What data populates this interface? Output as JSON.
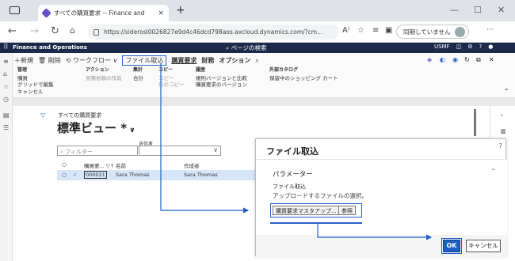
{
  "browser": {
    "tab_title": "すべての購買要求 -- Finance and",
    "tab_close": "×",
    "new_tab": "+",
    "url": "https://siderosl0026827e9d4c46dcd798aos.axcloud.dynamics.com/?cm...",
    "sync_label": "同期していません",
    "more": "···",
    "minimize": "—",
    "maximize": "☐",
    "close": "✕"
  },
  "app": {
    "name": "Finance and Operations",
    "search": "ページの検索",
    "company": "USMF"
  },
  "action_pane": {
    "new": "＋新規",
    "delete": "削除",
    "workflow": "ワークフロー",
    "file_import": "ファイル取込",
    "purchase_requisition": "購買要求",
    "finance": "財務",
    "options": "オプション",
    "groups": [
      {
        "header": "管理",
        "lines": [
          "購買",
          "グリッドで編集",
          "キャンセル"
        ]
      },
      {
        "header": "アクション",
        "lines": [
          "見積依頼の作成"
        ]
      },
      {
        "header": "集計",
        "lines": [
          "合計"
        ]
      },
      {
        "header": "コピー",
        "lines": [
          "コピー",
          "行のコピー"
        ]
      },
      {
        "header": "履歴",
        "lines": [
          "規則バージョンと比較",
          "購買要求のバージョン"
        ]
      },
      {
        "header": "外部カタログ",
        "lines": [
          "保留中のショッピング カート"
        ]
      }
    ]
  },
  "list": {
    "breadcrumb": "すべての購買要求",
    "view_title": "標準ビュー *",
    "filter_placeholder": "フィルター",
    "lookup_label": "送信者",
    "columns": [
      "購買要...",
      "名前",
      "作成者"
    ],
    "row": {
      "id": "000021",
      "name": "Sara Thomas",
      "created_by": "Sara Thomas"
    }
  },
  "dialog": {
    "title": "ファイル取込",
    "help": "?",
    "section": "パラメーター",
    "field_label": "ファイル取込",
    "field_help": "アップロードするファイルの選択。",
    "file_button": "購買要求マスタアップ...",
    "browse_button": "参照",
    "ok": "OK",
    "cancel": "キャンセル"
  },
  "colors": {
    "accent": "#2a63c9",
    "header_bg": "#1b2a4a",
    "selected_row": "#d6e5f8"
  }
}
